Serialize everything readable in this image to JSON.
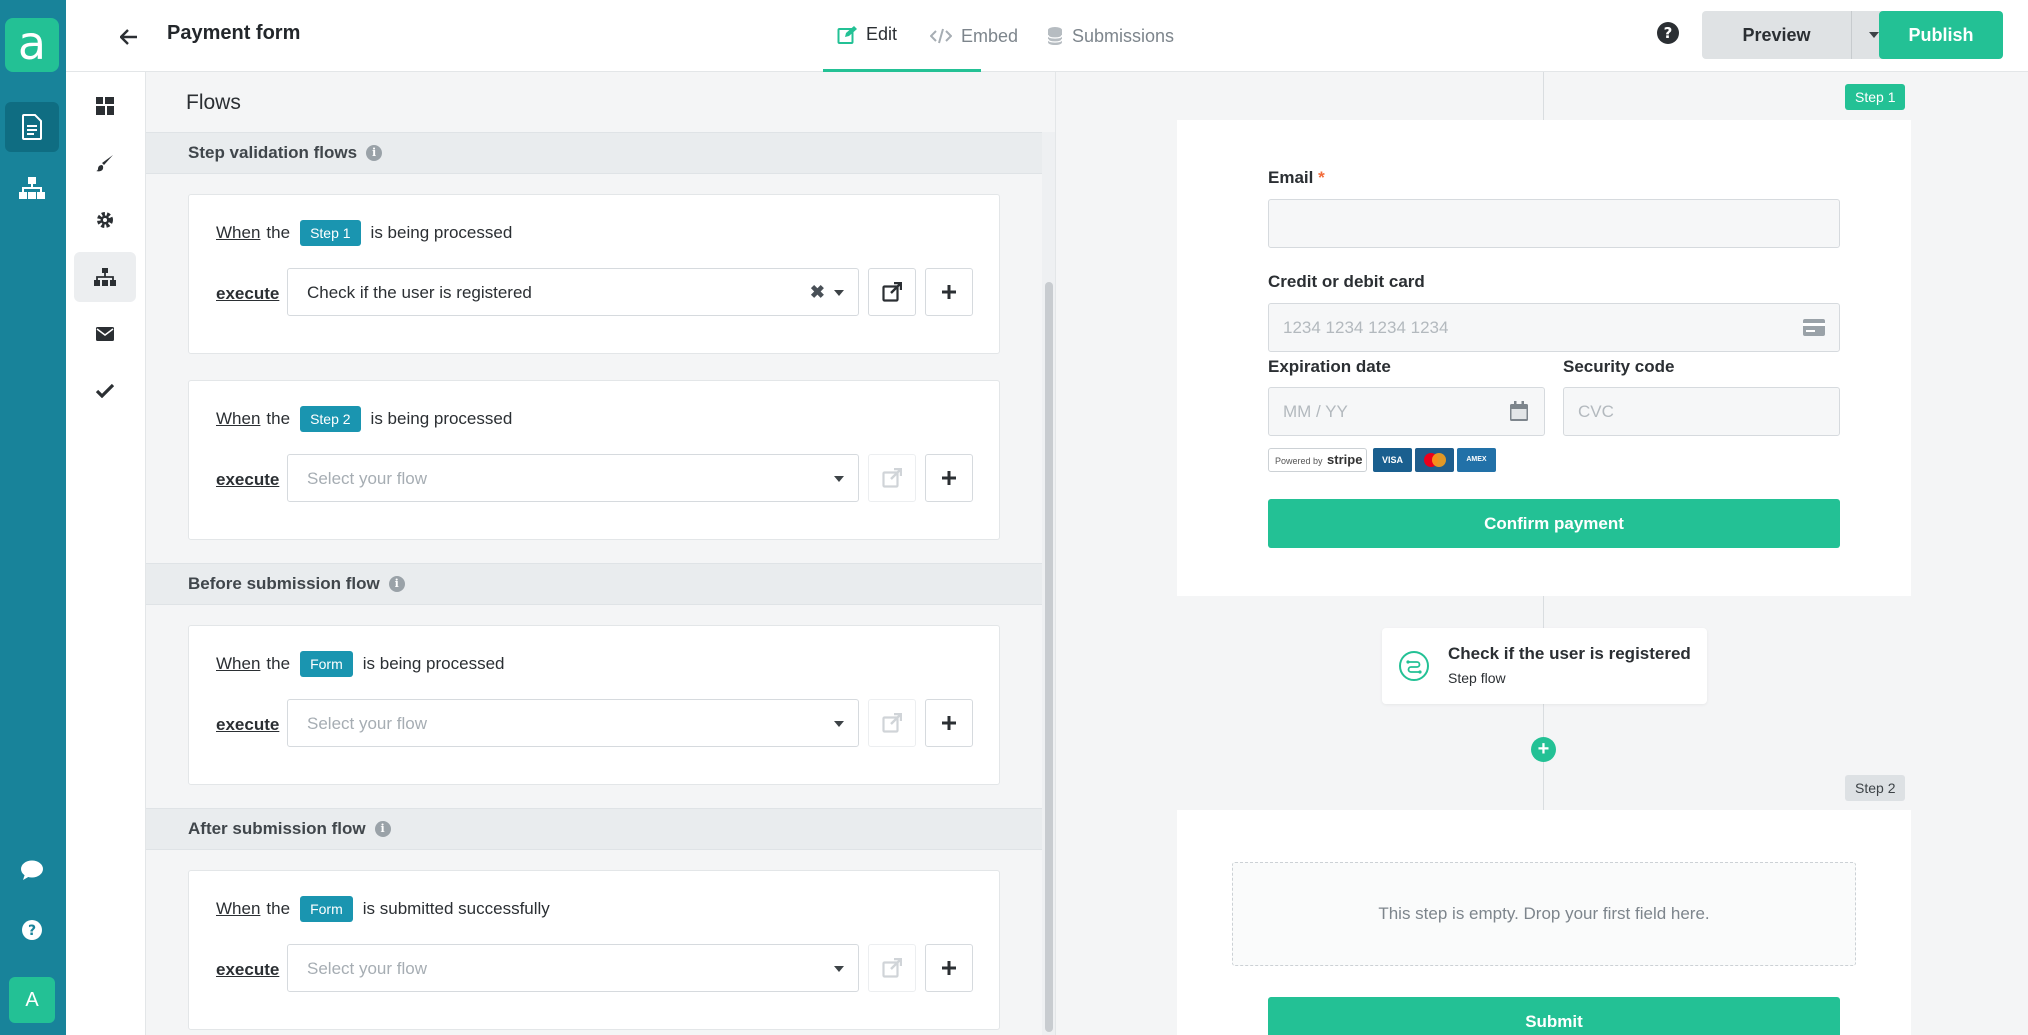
{
  "app": {
    "logo_letter": "a",
    "avatar_letter": "A"
  },
  "header": {
    "title": "Payment form",
    "tabs": [
      {
        "label": "Edit",
        "active": true
      },
      {
        "label": "Embed",
        "active": false
      },
      {
        "label": "Submissions",
        "active": false
      }
    ],
    "preview_label": "Preview",
    "publish_label": "Publish"
  },
  "flows": {
    "title": "Flows",
    "sections": [
      {
        "title": "Step validation flows"
      },
      {
        "title": "Before submission flow"
      },
      {
        "title": "After submission flow"
      }
    ],
    "cards": [
      {
        "when": "When",
        "the": "the",
        "tag": "Step 1",
        "suffix": "is being processed",
        "execute": "execute",
        "selected": "Check if the user is registered"
      },
      {
        "when": "When",
        "the": "the",
        "tag": "Step 2",
        "suffix": "is being processed",
        "execute": "execute",
        "placeholder": "Select your flow"
      },
      {
        "when": "When",
        "the": "the",
        "tag": "Form",
        "suffix": "is being processed",
        "execute": "execute",
        "placeholder": "Select your flow"
      },
      {
        "when": "When",
        "the": "the",
        "tag": "Form",
        "suffix": "is submitted successfully",
        "execute": "execute",
        "placeholder": "Select your flow"
      }
    ]
  },
  "preview": {
    "step1_badge": "Step 1",
    "step2_badge": "Step 2",
    "email_label": "Email",
    "required_mark": "*",
    "card_label": "Credit or debit card",
    "card_placeholder": "1234 1234 1234 1234",
    "expiration_label": "Expiration date",
    "expiration_placeholder": "MM / YY",
    "security_label": "Security code",
    "security_placeholder": "CVC",
    "powered_by": "Powered by",
    "stripe": "stripe",
    "card_brands": [
      "VISA",
      "MC",
      "AMEX"
    ],
    "confirm_label": "Confirm payment",
    "flow_node_title": "Check if the user is registered",
    "flow_node_subtitle": "Step flow",
    "empty_step": "This step is empty. Drop your first field here.",
    "submit_label": "Submit"
  },
  "colors": {
    "rail": "#18839a",
    "accent": "#23c195",
    "tag": "#1a95b0"
  },
  "icons": {
    "rail": [
      "logo",
      "document-icon",
      "sitemap-icon",
      "chat-icon",
      "help-icon"
    ],
    "subnav": [
      "dashboard-icon",
      "brush-icon",
      "gear-icon",
      "sitemap-icon",
      "envelope-icon",
      "check-icon"
    ]
  }
}
